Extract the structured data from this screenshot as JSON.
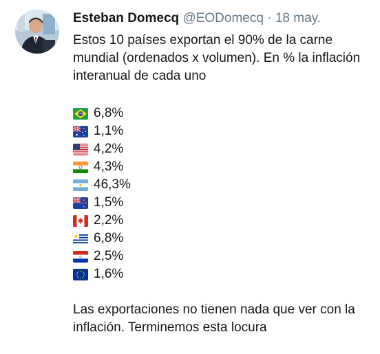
{
  "tweet": {
    "author": {
      "name": "Esteban Domecq",
      "handle": "@EODomecq",
      "separator": "·",
      "date": "18 may."
    },
    "intro": "Estos 10 países exportan el 90% de la carne mundial (ordenados x volumen). En % la inflación interanual de cada uno",
    "countries": [
      {
        "flag": "brazil-flag-icon",
        "value": "6,8%"
      },
      {
        "flag": "australia-flag-icon",
        "value": "1,1%"
      },
      {
        "flag": "usa-flag-icon",
        "value": "4,2%"
      },
      {
        "flag": "india-flag-icon",
        "value": "4,3%"
      },
      {
        "flag": "argentina-flag-icon",
        "value": "46,3%"
      },
      {
        "flag": "new-zealand-flag-icon",
        "value": "1,5%"
      },
      {
        "flag": "canada-flag-icon",
        "value": "2,2%"
      },
      {
        "flag": "uruguay-flag-icon",
        "value": "6,8%"
      },
      {
        "flag": "paraguay-flag-icon",
        "value": "2,5%"
      },
      {
        "flag": "eu-flag-icon",
        "value": "1,6%"
      }
    ],
    "outro": "Las exportaciones no tienen nada que ver con la inflación. Terminemos esta locura"
  }
}
